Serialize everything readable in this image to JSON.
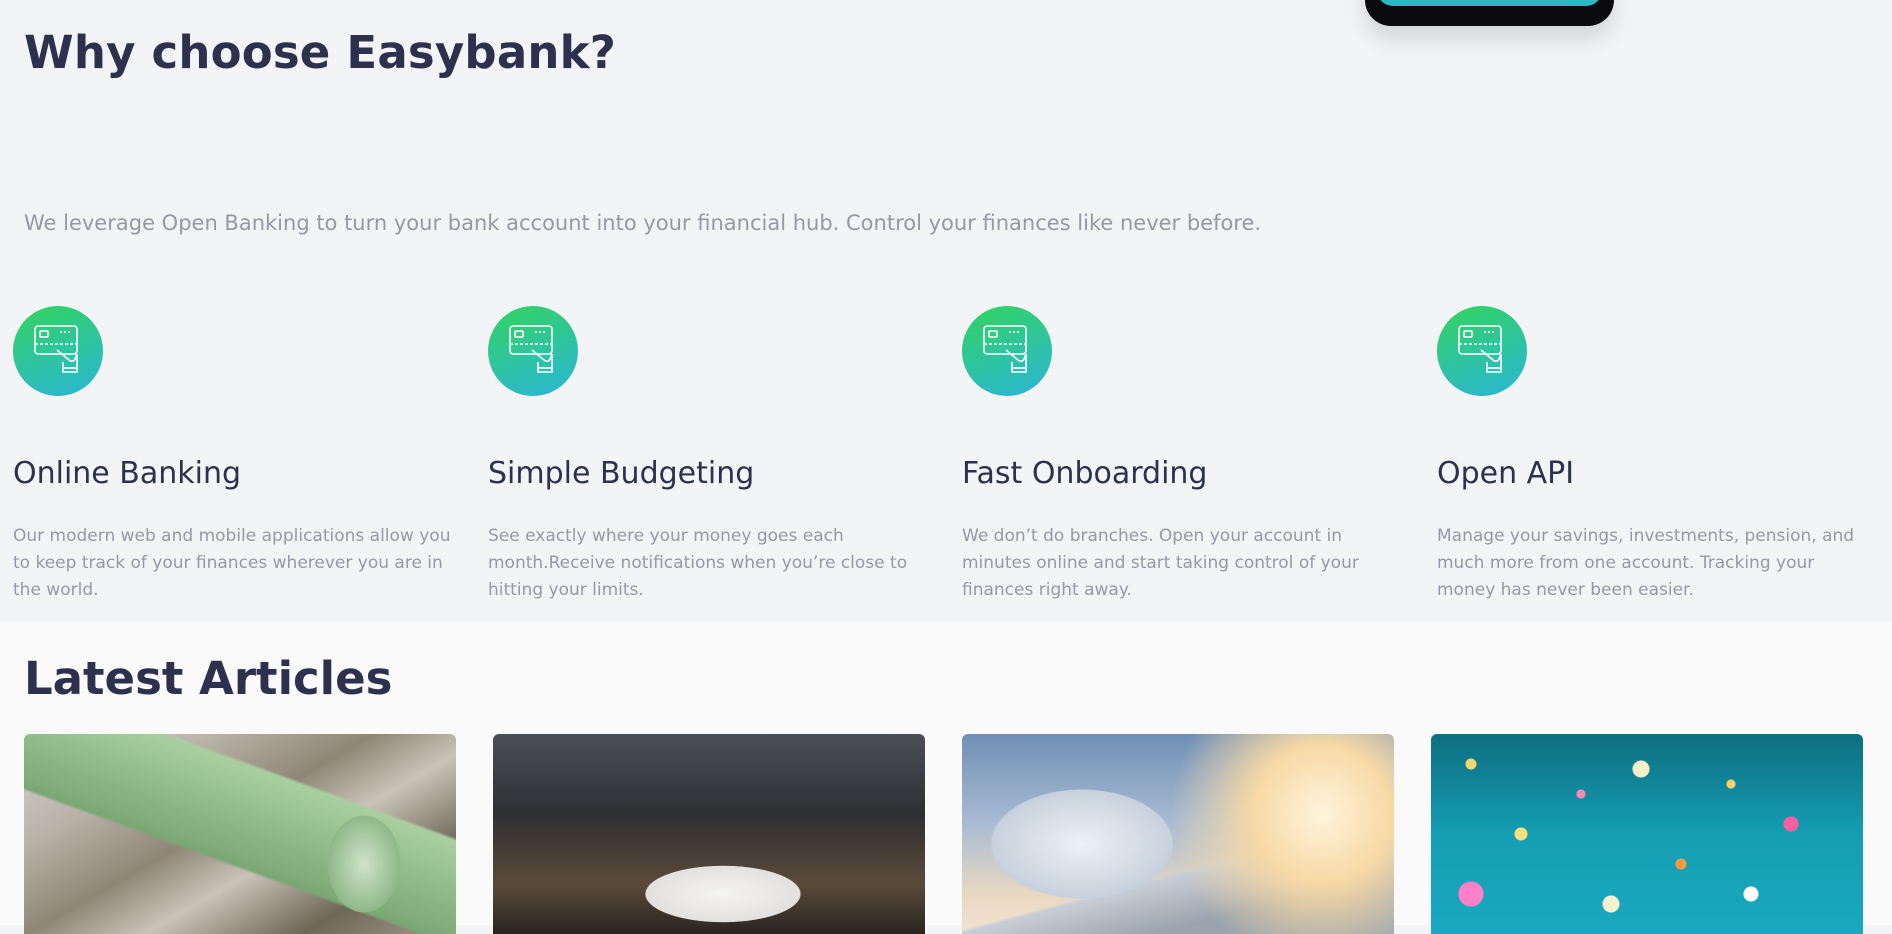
{
  "why": {
    "title": "Why choose Easybank?",
    "intro": "We leverage Open Banking to turn your bank account into your financial hub. Control your finances like never before.",
    "features": [
      {
        "icon": "credit-card-hand-icon",
        "title": "Online Banking",
        "text": "Our modern web and mobile applications allow you to keep track of your finances wherever you are in the world."
      },
      {
        "icon": "credit-card-hand-icon",
        "title": "Simple Budgeting",
        "text": "See exactly where your money goes each month.Receive notifications when you’re close to hitting your limits."
      },
      {
        "icon": "credit-card-hand-icon",
        "title": "Fast Onboarding",
        "text": "We don’t do branches. Open your account in minutes online and start taking control of your finances right away."
      },
      {
        "icon": "credit-card-hand-icon",
        "title": "Open API",
        "text": "Manage your savings, investments, pension, and much more from one account. Tracking your money has never been easier."
      }
    ]
  },
  "articles": {
    "title": "Latest Articles"
  },
  "colors": {
    "heading": "#2d314d",
    "body_text": "#9698a6",
    "gradient_start": "#33d35e",
    "gradient_end": "#2ab6d9",
    "section_bg": "#f3f4f6",
    "articles_bg": "#fafafa"
  }
}
